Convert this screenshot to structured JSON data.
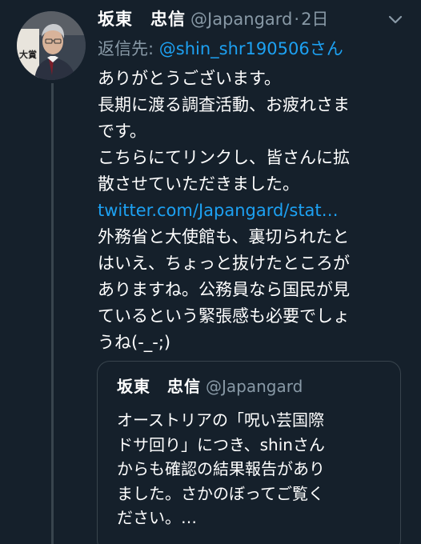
{
  "tweet": {
    "author_name": "坂東　忠信",
    "author_handle": "@Japangard",
    "separator": "·",
    "time": "2日",
    "reply_label": "返信先: ",
    "reply_mention": "@shin_shr190506",
    "reply_suffix": "さん",
    "body_lines": [
      "ありがとうございます。",
      "長期に渡る調査活動、お疲れさま",
      "です。",
      "こちらにてリンクし、皆さんに拡",
      "散させていただきました。"
    ],
    "link_text": "twitter.com/Japangard/stat…",
    "body_lines_after_link": [
      "外務省と大使館も、裏切られたと",
      "はいえ、ちょっと抜けたところが",
      "ありますね。公務員なら国民が見",
      "ているという緊張感も必要でしょ",
      "うね(-_-;)"
    ],
    "more_icon": "chevron-down-icon",
    "avatar_text": "大賞"
  },
  "quoted_tweet": {
    "author_name": "坂東　忠信",
    "author_handle": "@Japangard",
    "text_lines": [
      "オーストリアの「呪い芸国際",
      "ドサ回り」につき、shinさん",
      "からも確認の結果報告があり",
      "ました。さかのぼってご覧く",
      "ださい。…"
    ]
  },
  "colors": {
    "background": "#15202b",
    "text_primary": "#ffffff",
    "text_secondary": "#8899a6",
    "accent": "#1da1f2",
    "border": "#38444d"
  }
}
